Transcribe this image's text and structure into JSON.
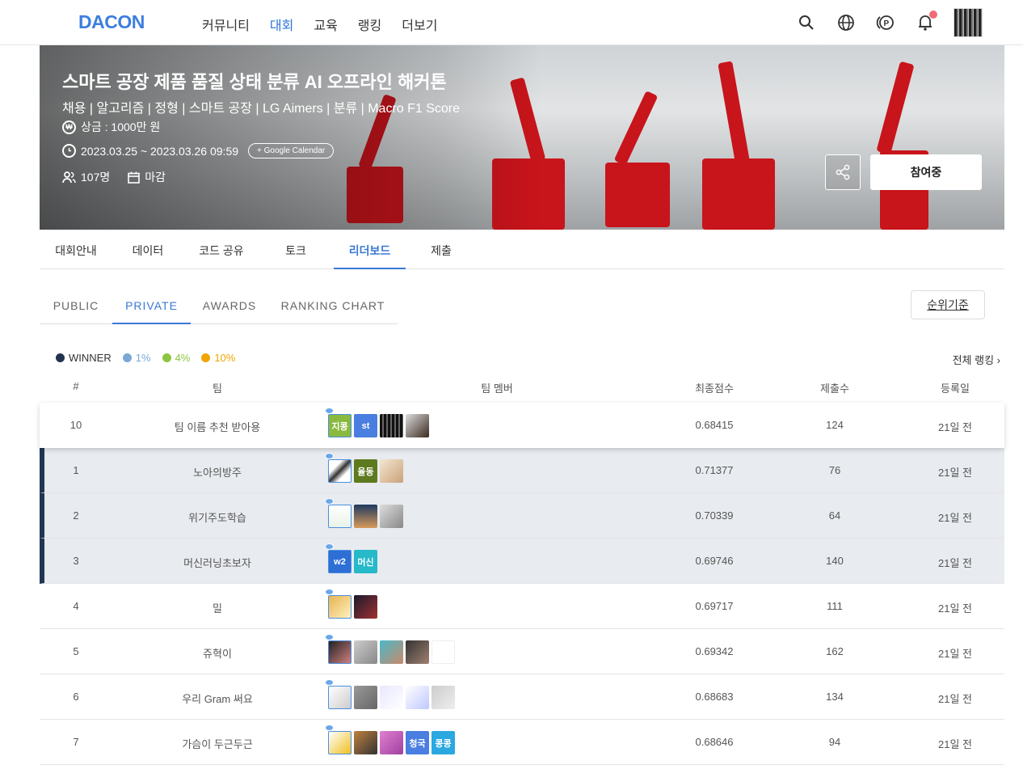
{
  "nav": {
    "logo": "DACON",
    "menu": [
      "커뮤니티",
      "대회",
      "교육",
      "랭킹",
      "더보기"
    ],
    "active_menu": "대회",
    "icons": [
      "search-icon",
      "globe-icon",
      "point-icon",
      "bell-icon",
      "avatar"
    ]
  },
  "banner": {
    "title": "스마트 공장 제품 품질 상태 분류 AI 오프라인 해커톤",
    "tags": "채용 | 알고리즘 | 정형 | 스마트 공장 | LG Aimers | 분류 | Macro F1 Score",
    "prize": "상금 : 1000만 원",
    "period": "2023.03.25 ~ 2023.03.26 09:59",
    "calendar_button": "+ Google Calendar",
    "participants": "107명",
    "status": "마감",
    "join_button": "참여중"
  },
  "main_tabs": [
    "대회안내",
    "데이터",
    "코드 공유",
    "토크",
    "리더보드",
    "제출"
  ],
  "active_main_tab": "리더보드",
  "sub_tabs": [
    "PUBLIC",
    "PRIVATE",
    "AWARDS",
    "RANKING CHART"
  ],
  "active_sub_tab": "PRIVATE",
  "rank_criteria_button": "순위기준",
  "legend": [
    {
      "label": "WINNER",
      "color": "#22334f"
    },
    {
      "label": "1%",
      "color": "#7aa7d6"
    },
    {
      "label": "4%",
      "color": "#8cc63f"
    },
    {
      "label": "10%",
      "color": "#f0a500"
    }
  ],
  "all_ranking_link": "전체 랭킹 ›",
  "table": {
    "headers": [
      "#",
      "팀",
      "팀 멤버",
      "최종점수",
      "제출수",
      "등록일"
    ],
    "rows": [
      {
        "rank": "10",
        "team": "팀 이름 추천 받아용",
        "score": "0.68415",
        "submissions": "124",
        "registered": "21일 전",
        "members": [
          "지콩",
          "st",
          "",
          ""
        ]
      },
      {
        "rank": "1",
        "team": "노아의방주",
        "score": "0.71377",
        "submissions": "76",
        "registered": "21일 전",
        "members": [
          "",
          "율동",
          ""
        ]
      },
      {
        "rank": "2",
        "team": "위기주도학습",
        "score": "0.70339",
        "submissions": "64",
        "registered": "21일 전",
        "members": [
          "",
          "",
          ""
        ]
      },
      {
        "rank": "3",
        "team": "머신러닝초보자",
        "score": "0.69746",
        "submissions": "140",
        "registered": "21일 전",
        "members": [
          "w2",
          "머신"
        ]
      },
      {
        "rank": "4",
        "team": "밀",
        "score": "0.69717",
        "submissions": "111",
        "registered": "21일 전",
        "members": [
          "",
          ""
        ]
      },
      {
        "rank": "5",
        "team": "쥬혁이",
        "score": "0.69342",
        "submissions": "162",
        "registered": "21일 전",
        "members": [
          "",
          "",
          "",
          "",
          ""
        ]
      },
      {
        "rank": "6",
        "team": "우리 Gram 써요",
        "score": "0.68683",
        "submissions": "134",
        "registered": "21일 전",
        "members": [
          "",
          "",
          "",
          "",
          ""
        ]
      },
      {
        "rank": "7",
        "team": "가슴이 두근두근",
        "score": "0.68646",
        "submissions": "94",
        "registered": "21일 전",
        "members": [
          "",
          "",
          "",
          "청국",
          "콩콩"
        ]
      }
    ]
  }
}
